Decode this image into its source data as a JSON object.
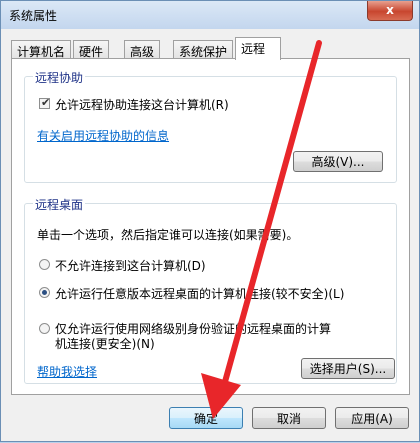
{
  "window": {
    "title": "系统属性",
    "close_label": "x"
  },
  "tabs": [
    {
      "label": "计算机名"
    },
    {
      "label": "硬件"
    },
    {
      "label": "高级"
    },
    {
      "label": "系统保护"
    },
    {
      "label": "远程"
    }
  ],
  "remote_assistance": {
    "title": "远程协助",
    "checkbox_label": "允许远程协助连接这台计算机(R)",
    "checked": true,
    "info_link": "有关启用远程协助的信息",
    "advanced_button": "高级(V)..."
  },
  "remote_desktop": {
    "title": "远程桌面",
    "instruction": "单击一个选项，然后指定谁可以连接(如果需要)。",
    "options": [
      {
        "label": "不允许连接到这台计算机(D)",
        "selected": false
      },
      {
        "label": "允许运行任意版本远程桌面的计算机连接(较不安全)(L)",
        "selected": true
      },
      {
        "label_line1": "仅允许运行使用网络级别身份验证的远程桌面的计算",
        "label_line2": "机连接(更安全)(N)",
        "selected": false
      }
    ],
    "help_link": "帮助我选择",
    "select_users_button": "选择用户(S)..."
  },
  "footer": {
    "ok": "确定",
    "cancel": "取消",
    "apply": "应用(A)"
  },
  "annotation": {
    "arrow_color": "#e8262a"
  }
}
